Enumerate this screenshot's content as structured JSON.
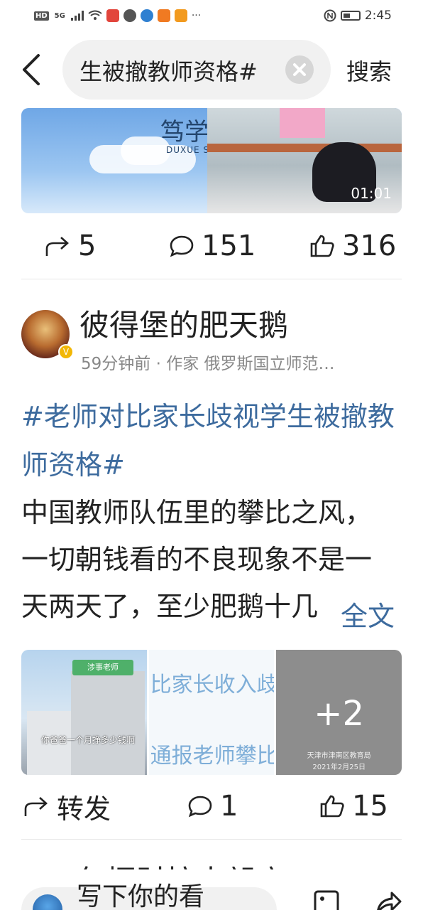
{
  "status_bar": {
    "left_badges": [
      "HD",
      "5G"
    ],
    "time": "2:45"
  },
  "search": {
    "query": "生被撤教师资格#",
    "search_button_label": "搜索"
  },
  "previous_post": {
    "video": {
      "logo_cn": "笃学",
      "logo_en": "DUXUE S",
      "duration": "01:01"
    },
    "actions": {
      "repost_count": "5",
      "comment_count": "151",
      "like_count": "316"
    }
  },
  "post": {
    "author": "彼得堡的肥天鹅",
    "meta": "59分钟前 · 作家 俄罗斯国立师范…",
    "hashtag": "#老师对比家长歧视学生被撤教师资格#",
    "body_lines": [
      "中国教师队伍里的攀比之风，",
      "一切朝钱看的不良现象不是一",
      "天两天了，至少肥鹅十几"
    ],
    "more_label": "全文",
    "images": {
      "tile1_tag": "涉事老师",
      "tile1_caption": "你爸爸一个月挣多少钱啊",
      "tile2_line1": "比家长收入歧视",
      "tile2_line2": "通报老师攀比家",
      "tile3_more": "+2",
      "tile3_footer1": "天津市津南区教育局",
      "tile3_footer2": "2021年2月25日"
    },
    "actions": {
      "repost_label": "转发",
      "comment_count": "1",
      "like_count": "15"
    }
  },
  "next_post": {
    "author_partial": "包捆财掠大朗店"
  },
  "comment_bar": {
    "placeholder": "写下你的看"
  }
}
